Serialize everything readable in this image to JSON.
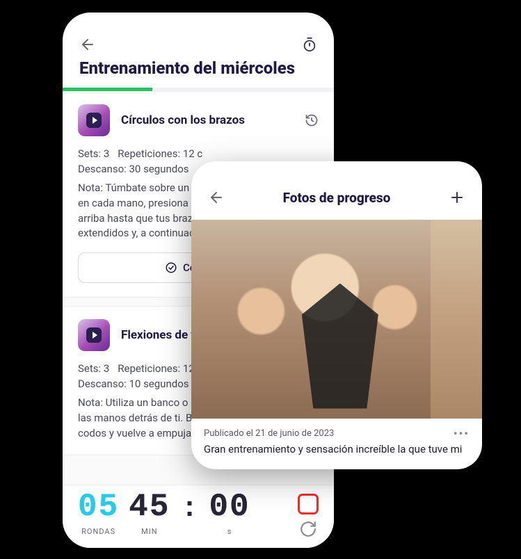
{
  "workout": {
    "title": "Entrenamiento del miércoles",
    "progress_pct": 33,
    "exercises": [
      {
        "name": "Círculos con los brazos",
        "sets": "Sets: 3",
        "reps": "Repeticiones: 12 c",
        "rest": "Descanso: 30 segundos",
        "note": "Nota: Túmbate sobre un banco con una mancuerna en cada mano, presiona las mancuernas hacia arriba hasta que tus brazos queden completamente extendidos y, a continuación, vuelve a bajar.",
        "complete_label": "Completar"
      },
      {
        "name": "Flexiones de tríceps",
        "sets": "Sets: 3",
        "reps": "Repeticiones: 12",
        "rest": "Descanso: 10 segundos",
        "note": "Nota: Utiliza un banco o una silla estable y coloca las manos detrás de ti. Baja el cuerpo doblando los codos y vuelve a empujar hacia arriba."
      }
    ],
    "timer": {
      "rounds": "05",
      "rounds_label": "RONDAS",
      "min": "45",
      "min_label": "MIN",
      "sec": "00",
      "sec_label": "s"
    }
  },
  "progress": {
    "title": "Fotos de progreso",
    "date": "Publicado el 21 de junio de 2023",
    "caption": "Gran entrenamiento y sensación increíble la que tuve mi"
  }
}
